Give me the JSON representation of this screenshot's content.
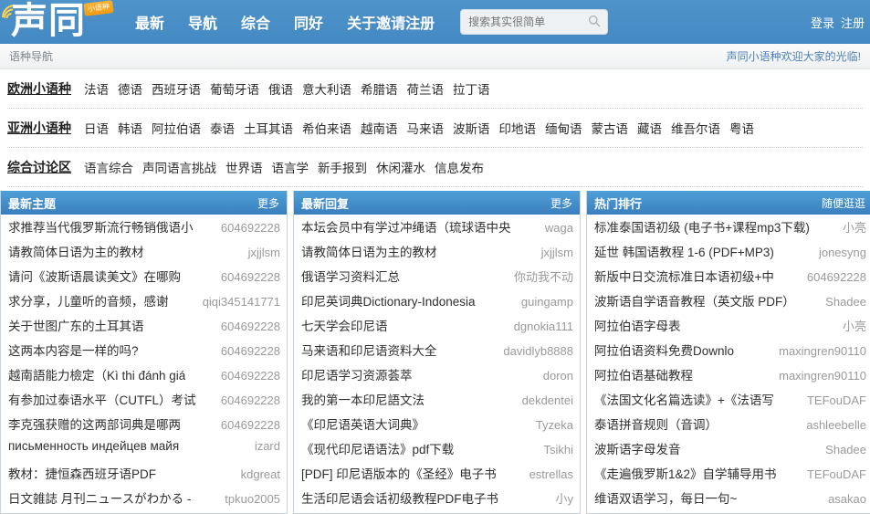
{
  "header": {
    "logo_text": "声同",
    "logo_badge": "小语种",
    "nav": [
      {
        "label": "最新"
      },
      {
        "label": "导航"
      },
      {
        "label": "综合"
      },
      {
        "label": "同好"
      },
      {
        "label": "关于邀请注册"
      }
    ],
    "search": {
      "placeholder": "搜索其实很简单",
      "value": "",
      "icon": "search-icon"
    },
    "login_label": "登录",
    "register_label": "注册",
    "brand_color": "#4a8fc6",
    "badge_color": "#f5a623"
  },
  "subbar": {
    "label": "语种导航",
    "welcome": "声同小语种欢迎大家的光临!"
  },
  "langnav": [
    {
      "category": "欧洲小语种",
      "items": [
        "法语",
        "德语",
        "西班牙语",
        "葡萄牙语",
        "俄语",
        "意大利语",
        "希腊语",
        "荷兰语",
        "拉丁语"
      ]
    },
    {
      "category": "亚洲小语种",
      "items": [
        "日语",
        "韩语",
        "阿拉伯语",
        "泰语",
        "土耳其语",
        "希伯来语",
        "越南语",
        "马来语",
        "波斯语",
        "印地语",
        "缅甸语",
        "蒙古语",
        "藏语",
        "维吾尔语",
        "粤语"
      ]
    },
    {
      "category": "综合讨论区",
      "items": [
        "语言综合",
        "声同语言挑战",
        "世界语",
        "语言学",
        "新手报到",
        "休闲灌水",
        "信息发布"
      ]
    }
  ],
  "panels": [
    {
      "title": "最新主题",
      "more_label": "更多",
      "rows": [
        {
          "title": "求推荐当代俄罗斯流行畅销俄语小",
          "author": "604692228"
        },
        {
          "title": "请教简体日语为主的教材",
          "author": "jxjjlsm"
        },
        {
          "title": "请问《波斯语晨读美文》在哪购",
          "author": "604692228"
        },
        {
          "title": "求分享，儿童听的音频，感谢",
          "author": "qiqi345141771"
        },
        {
          "title": "关于世图广东的土耳其语",
          "author": "604692228"
        },
        {
          "title": "这两本内容是一样的吗?",
          "author": "604692228"
        },
        {
          "title": "越南語能力檢定（Kì thi đánh giá",
          "author": "604692228"
        },
        {
          "title": "有参加过泰语水平（CUTFL）考试",
          "author": "604692228"
        },
        {
          "title": "李克强获赠的这两部词典是哪两",
          "author": "604692228"
        },
        {
          "title": "письменность индейцев майя",
          "author": "izard"
        },
        {
          "title": "教材：捷恒森西班牙语PDF",
          "author": "kdgreat"
        },
        {
          "title": "日文雑誌 月刊ニュースがわかる -",
          "author": "tpkuo2005"
        }
      ]
    },
    {
      "title": "最新回复",
      "more_label": "更多",
      "rows": [
        {
          "title": "本坛会员中有学过冲绳语（琉球语中央",
          "author": "waga"
        },
        {
          "title": "请教简体日语为主的教材",
          "author": "jxjjlsm"
        },
        {
          "title": "俄语学习资料汇总",
          "author": "你动我不动"
        },
        {
          "title": "印尼英词典Dictionary-Indonesia",
          "author": "guingamp"
        },
        {
          "title": "七天学会印尼语",
          "author": "dgnokia111"
        },
        {
          "title": "马来语和印尼语资料大全",
          "author": "davidlyb8888"
        },
        {
          "title": "印尼语学习资源荟萃",
          "author": "doron"
        },
        {
          "title": "我的第一本印尼語文法",
          "author": "dekdentei"
        },
        {
          "title": "《印尼语英语大词典》",
          "author": "Tyzeka"
        },
        {
          "title": "《现代印尼语语法》pdf下载",
          "author": "Tsikhi"
        },
        {
          "title": "[PDF] 印尼语版本的《圣经》电子书",
          "author": "estrellas"
        },
        {
          "title": "生活印尼语会话初级教程PDF电子书",
          "author": "小y"
        }
      ]
    },
    {
      "title": "热门排行",
      "more_label": "随便逛逛",
      "rows": [
        {
          "title": "标准泰国语初级 (电子书+课程mp3下载)",
          "author": "小亮"
        },
        {
          "title": "延世 韩国语教程 1-6 (PDF+MP3)",
          "author": "jonesyng"
        },
        {
          "title": "新版中日交流标准日本语初级+中",
          "author": "604692228"
        },
        {
          "title": "波斯语自学语音教程（英文版 PDF）",
          "author": "Shadee"
        },
        {
          "title": "阿拉伯语字母表",
          "author": "小亮"
        },
        {
          "title": "阿拉伯语资料免费Downlo",
          "author": "maxingren90110"
        },
        {
          "title": "阿拉伯语基础教程",
          "author": "maxingren90110"
        },
        {
          "title": "《法国文化名篇选读》+《法语写",
          "author": "TEFouDAF"
        },
        {
          "title": "泰语拼音规则（音调）",
          "author": "ashleebelle"
        },
        {
          "title": "波斯语字母发音",
          "author": "Shadee"
        },
        {
          "title": "《走遍俄罗斯1&2》自学辅导用书",
          "author": "TEFouDAF"
        },
        {
          "title": "维语双语学习，每日一句~",
          "author": "asakao"
        }
      ]
    }
  ]
}
